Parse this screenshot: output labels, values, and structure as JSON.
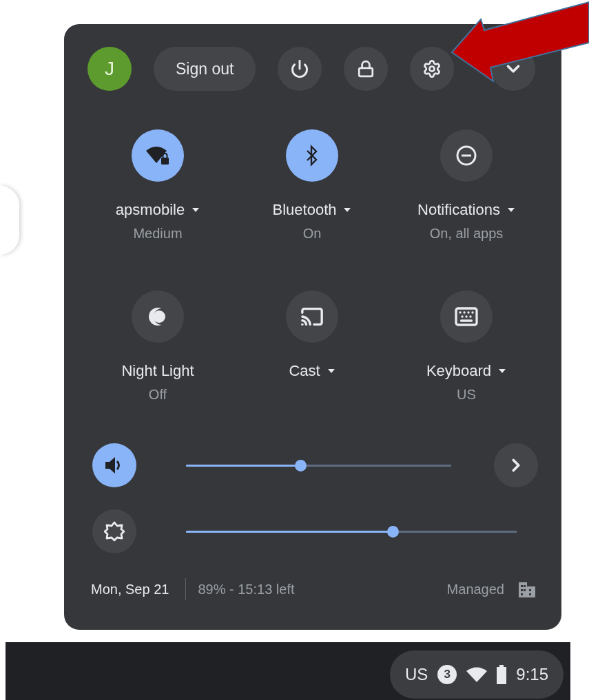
{
  "user": {
    "initial": "J"
  },
  "top_buttons": [
    {
      "kind": "sign_out",
      "label": "Sign out"
    },
    {
      "kind": "power"
    },
    {
      "kind": "lock"
    },
    {
      "kind": "settings"
    },
    {
      "kind": "collapse"
    }
  ],
  "tiles": [
    {
      "kind": "network",
      "label": "apsmobile",
      "sublabel": "Medium",
      "on": true,
      "dropdown": true
    },
    {
      "kind": "bluetooth",
      "label": "Bluetooth",
      "sublabel": "On",
      "on": true,
      "dropdown": true
    },
    {
      "kind": "notifications",
      "label": "Notifications",
      "sublabel": "On, all apps",
      "on": false,
      "dropdown": true
    },
    {
      "kind": "night_light",
      "label": "Night Light",
      "sublabel": "Off",
      "on": false,
      "dropdown": false
    },
    {
      "kind": "cast",
      "label": "Cast",
      "on": false,
      "dropdown": true
    },
    {
      "kind": "keyboard",
      "label": "Keyboard",
      "sublabel": "US",
      "on": false,
      "dropdown": true
    }
  ],
  "sliders": [
    {
      "kind": "volume",
      "on": true,
      "level": 0.43
    },
    {
      "kind": "brightness",
      "on": false,
      "level": 0.625
    }
  ],
  "footer": {
    "date": "Mon, Sep 21",
    "battery": "89% - 15:13 left",
    "managed": "Managed"
  },
  "shelf": {
    "ime": "US",
    "notification_count": "3",
    "time": "9:15"
  }
}
